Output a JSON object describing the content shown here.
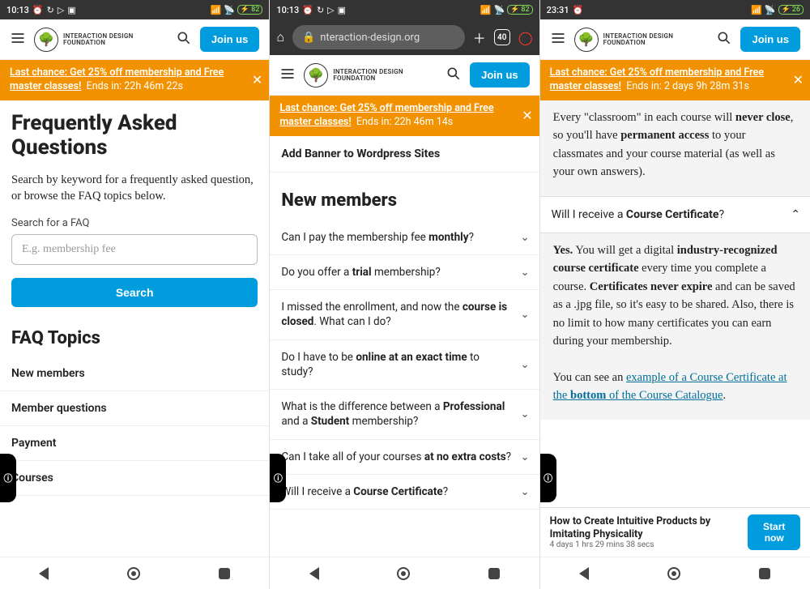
{
  "statusA": {
    "time": "10:13",
    "battery": "82"
  },
  "statusB": {
    "time": "10:13",
    "battery": "82"
  },
  "statusC": {
    "time": "23:31",
    "battery": "26"
  },
  "urlbar": {
    "host": "nteraction-design.org",
    "tabs": "40"
  },
  "header": {
    "brand1": "INTERACTION DESIGN",
    "brand2": "FOUNDATION",
    "join": "Join us"
  },
  "promoA": {
    "line1": "Last chance: Get 25% off membership and Free master classes!",
    "line2": "Ends in: 22h 46m 22s"
  },
  "promoB": {
    "line1": "Last chance: Get 25% off membership and Free master classes!",
    "line2": "Ends in: 22h 46m 14s"
  },
  "promoC": {
    "line1": "Last chance: Get 25% off membership and Free master classes!",
    "line2": "Ends in: 2 days 9h 28m 31s"
  },
  "s1": {
    "h1": "Frequently Asked Questions",
    "lead": "Search by keyword for a frequently asked question, or browse the FAQ topics below.",
    "search_label": "Search for a FAQ",
    "search_placeholder": "E.g. membership fee",
    "search_btn": "Search",
    "topics_h": "FAQ Topics",
    "topics": [
      "New members",
      "Member questions",
      "Payment",
      "Courses"
    ]
  },
  "s2": {
    "banner_item": "Add Banner to Wordpress Sites",
    "section": "New members",
    "faqs": [
      {
        "pre": "Can I pay the membership fee ",
        "b": "monthly",
        "post": "?"
      },
      {
        "pre": "Do you offer a ",
        "b": "trial",
        "post": " membership?"
      },
      {
        "pre": "I missed the enrollment, and now the ",
        "b": "course is closed",
        "post": ". What can I do?"
      },
      {
        "pre": "Do I have to be ",
        "b": "online at an exact time",
        "post": " to study?"
      },
      {
        "pre": "What is the difference between a ",
        "b": "Professional",
        "post": " and a ",
        "b2": "Student",
        "post2": " membership?"
      },
      {
        "pre": "Can I take all of your courses ",
        "b": "at no extra costs",
        "post": "?"
      },
      {
        "pre": "Will I receive a ",
        "b": "Course Certificate",
        "post": "?"
      }
    ]
  },
  "s3": {
    "ans1_a": "Every \"classroom\" in each course will ",
    "ans1_b": "never close",
    "ans1_c": ", so you'll have ",
    "ans1_d": "permanent access",
    "ans1_e": " to your classmates and your course material (as well as your own answers).",
    "q_pre": "Will I receive a ",
    "q_b": "Course Certificate",
    "q_post": "?",
    "ans2_a": "Yes.",
    "ans2_b": " You will get a digital ",
    "ans2_c": "industry-recognized course certificate",
    "ans2_d": " every time you complete a course. ",
    "ans2_e": "Certificates never expire",
    "ans2_f": " and can be saved as a .jpg file, so it's easy to be shared. Also, there is no limit to how many certificates you can earn during your membership.",
    "ans2_g": "You can see an ",
    "ans2_link1": "example of a Course Certificate at the ",
    "ans2_link_b": "bottom",
    "ans2_link2": " of the Course Catalogue",
    "ans2_h": ".",
    "cta_title": "How to Create Intuitive Products by Imitating Physicality",
    "cta_sub": "4 days 1 hrs 29 mins 38 secs",
    "cta_btn": "Start now"
  }
}
